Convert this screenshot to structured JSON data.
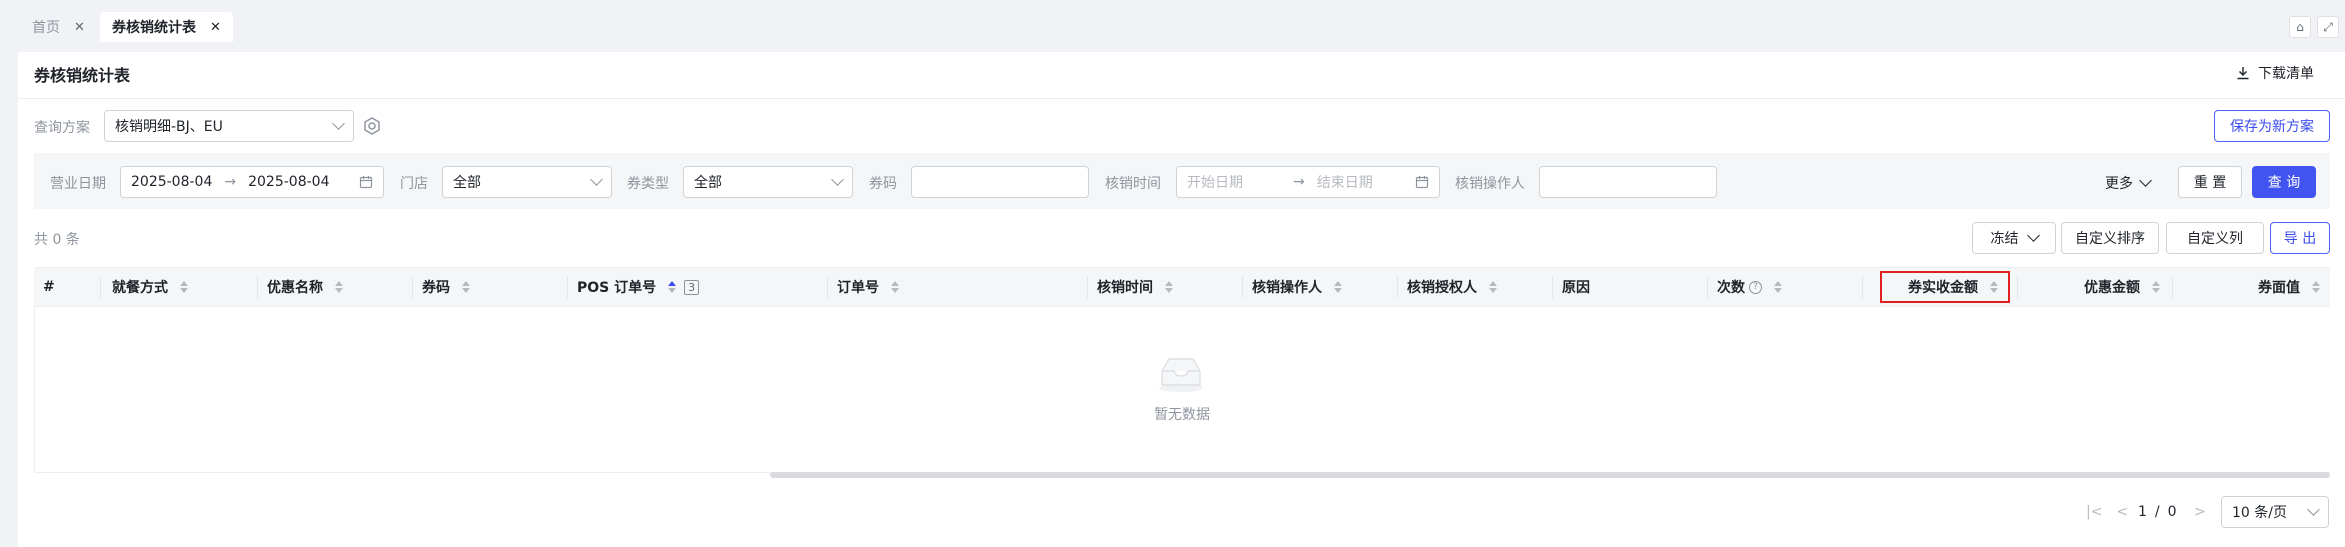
{
  "tabs": [
    {
      "label": "首页",
      "active": false
    },
    {
      "label": "券核销统计表",
      "active": true
    }
  ],
  "window_icons": [
    "home-icon",
    "fullscreen-icon"
  ],
  "page": {
    "title": "券核销统计表",
    "download_label": "下载清单"
  },
  "query_scheme": {
    "label": "查询方案",
    "value": "核销明细-BJ、EU",
    "save_new_label": "保存为新方案"
  },
  "filters": {
    "business_date_label": "营业日期",
    "date_start": "2025-08-04",
    "date_end": "2025-08-04",
    "store_label": "门店",
    "store_value": "全部",
    "coupon_type_label": "券类型",
    "coupon_type_value": "全部",
    "coupon_code_label": "券码",
    "coupon_code_value": "",
    "redeem_time_label": "核销时间",
    "redeem_time_start_placeholder": "开始日期",
    "redeem_time_end_placeholder": "结束日期",
    "operator_label": "核销操作人",
    "operator_value": "",
    "more_label": "更多",
    "reset_label": "重 置",
    "query_label": "查 询"
  },
  "toolbar": {
    "total": "共 0 条",
    "freeze_label": "冻结",
    "custom_sort_label": "自定义排序",
    "custom_columns_label": "自定义列",
    "export_label": "导 出"
  },
  "table": {
    "columns": [
      {
        "label": "#"
      },
      {
        "label": "就餐方式"
      },
      {
        "label": "优惠名称"
      },
      {
        "label": "券码"
      },
      {
        "label": "POS 订单号",
        "sort_active": "asc",
        "sort_badge": "3"
      },
      {
        "label": "订单号"
      },
      {
        "label": "核销时间"
      },
      {
        "label": "核销操作人"
      },
      {
        "label": "核销授权人"
      },
      {
        "label": "原因"
      },
      {
        "label": "次数"
      },
      {
        "label": "券实收金额",
        "highlighted": true
      },
      {
        "label": "优惠金额"
      },
      {
        "label": "券面值"
      }
    ],
    "empty_text": "暂无数据"
  },
  "pagination": {
    "current": "1",
    "separator": "/",
    "total_pages": "0",
    "page_size": "10 条/页"
  },
  "colors": {
    "primary": "#4254f0",
    "highlight_border": "#e02020"
  }
}
